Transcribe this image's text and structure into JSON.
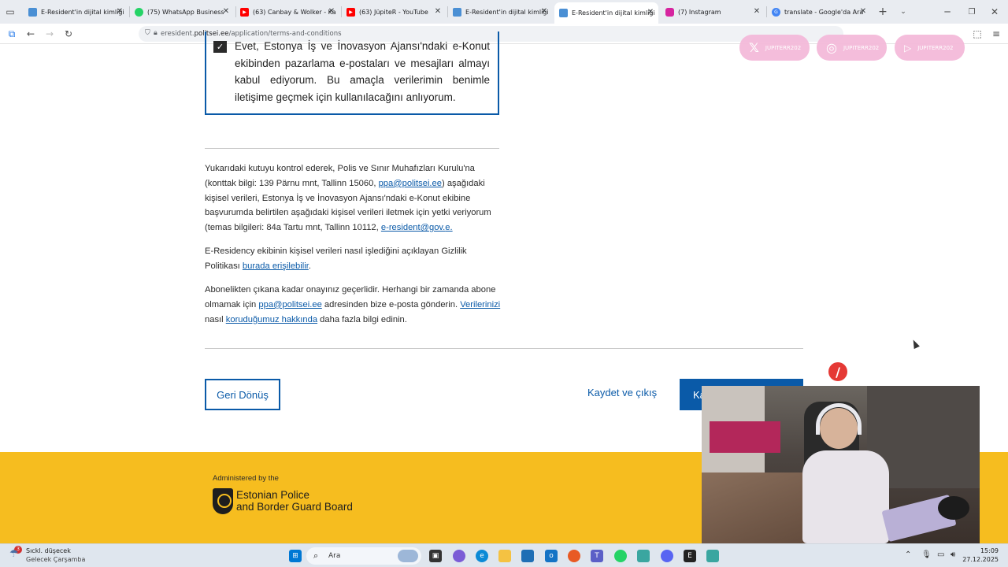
{
  "browser": {
    "tabs": [
      {
        "title": "E-Resident'in dijital kimliği",
        "favicon": "shield-icon",
        "color": "#4a8fd4",
        "active": false
      },
      {
        "title": "(75) WhatsApp Business",
        "favicon": "whatsapp-icon",
        "color": "#25d366",
        "badge": "75",
        "active": false
      },
      {
        "title": "(63) Canbay & Wolker - Ka",
        "favicon": "youtube-icon",
        "color": "#ff0000",
        "active": false
      },
      {
        "title": "(63) JüpiteR - YouTube",
        "favicon": "youtube-icon",
        "color": "#ff0000",
        "active": false
      },
      {
        "title": "E-Resident'in dijital kimliği",
        "favicon": "shield-icon",
        "color": "#4a8fd4",
        "active": false
      },
      {
        "title": "E-Resident'in dijital kimliği",
        "favicon": "shield-icon",
        "color": "#4a8fd4",
        "active": true
      },
      {
        "title": "(7) Instagram",
        "favicon": "instagram-icon",
        "color": "#d6249f",
        "active": false
      },
      {
        "title": "translate - Google'da Ara",
        "favicon": "google-icon",
        "color": "#4285f4",
        "active": false
      }
    ],
    "address": {
      "prefix": "eresident.",
      "host": "politsei.ee",
      "path": "/application/terms-and-conditions"
    },
    "overlay_pills": [
      "JUPITERR202",
      "JUPITERR202",
      "JUPITERR202"
    ]
  },
  "consent": {
    "checked": true,
    "text": "Evet, Estonya İş ve İnovasyon Ajansı'ndaki e-Konut ekibinden pazarlama e-postaları ve mesajları almayı kabul ediyorum. Bu amaçla verilerimin benimle iletişime geçmek için kullanılacağını anlıyorum."
  },
  "paragraphs": {
    "p1_a": "Yukarıdaki kutuyu kontrol ederek, Polis ve Sınır Muhafızları Kurulu'na (konttak bilgi: 139 Pärnu mnt, Tallinn 15060, ",
    "p1_link1": "ppa@politsei.ee",
    "p1_b": ") aşağıdaki kişisel verileri, Estonya İş ve İnovasyon Ajansı'ndaki e-Konut ekibine başvurumda belirtilen aşağıdaki kişisel verileri iletmek için yetki veriyorum (temas bilgileri: 84a Tartu mnt, Tallinn 10112, ",
    "p1_link2": "e-resident@gov.",
    "p1_c": "e.",
    "p2_a": "E-Residency ekibinin kişisel verileri nasıl işlediğini açıklayan Gizlilik Politikası ",
    "p2_link": "burada erişilebilir",
    "p2_b": ".",
    "p3_a": "Abonelikten çıkana kadar onayınız geçerlidir. Herhangi bir zamanda abone olmamak için ",
    "p3_link1": "ppa@politsei.ee",
    "p3_b": " adresinden bize e-posta gönderin. ",
    "p3_link2": "Verilerinizi",
    "p3_c": " nasıl ",
    "p3_link3": "koruduğumuz hakkında",
    "p3_d": " daha fazla bilgi edinin."
  },
  "actions": {
    "back": "Geri Dönüş",
    "save_exit": "Kaydet ve çıkış",
    "continue": "Ka"
  },
  "footer": {
    "administered_by": "Administered by the",
    "org_line1": "Estonian Police",
    "org_line2": "and Border Guard Board"
  },
  "taskbar": {
    "weather_badge": "3",
    "weather_title": "Sıckl. düşecek",
    "weather_sub": "Gelecek Çarşamba",
    "search_placeholder": "Ara",
    "time": "15:09",
    "date": "27.12.2025"
  }
}
